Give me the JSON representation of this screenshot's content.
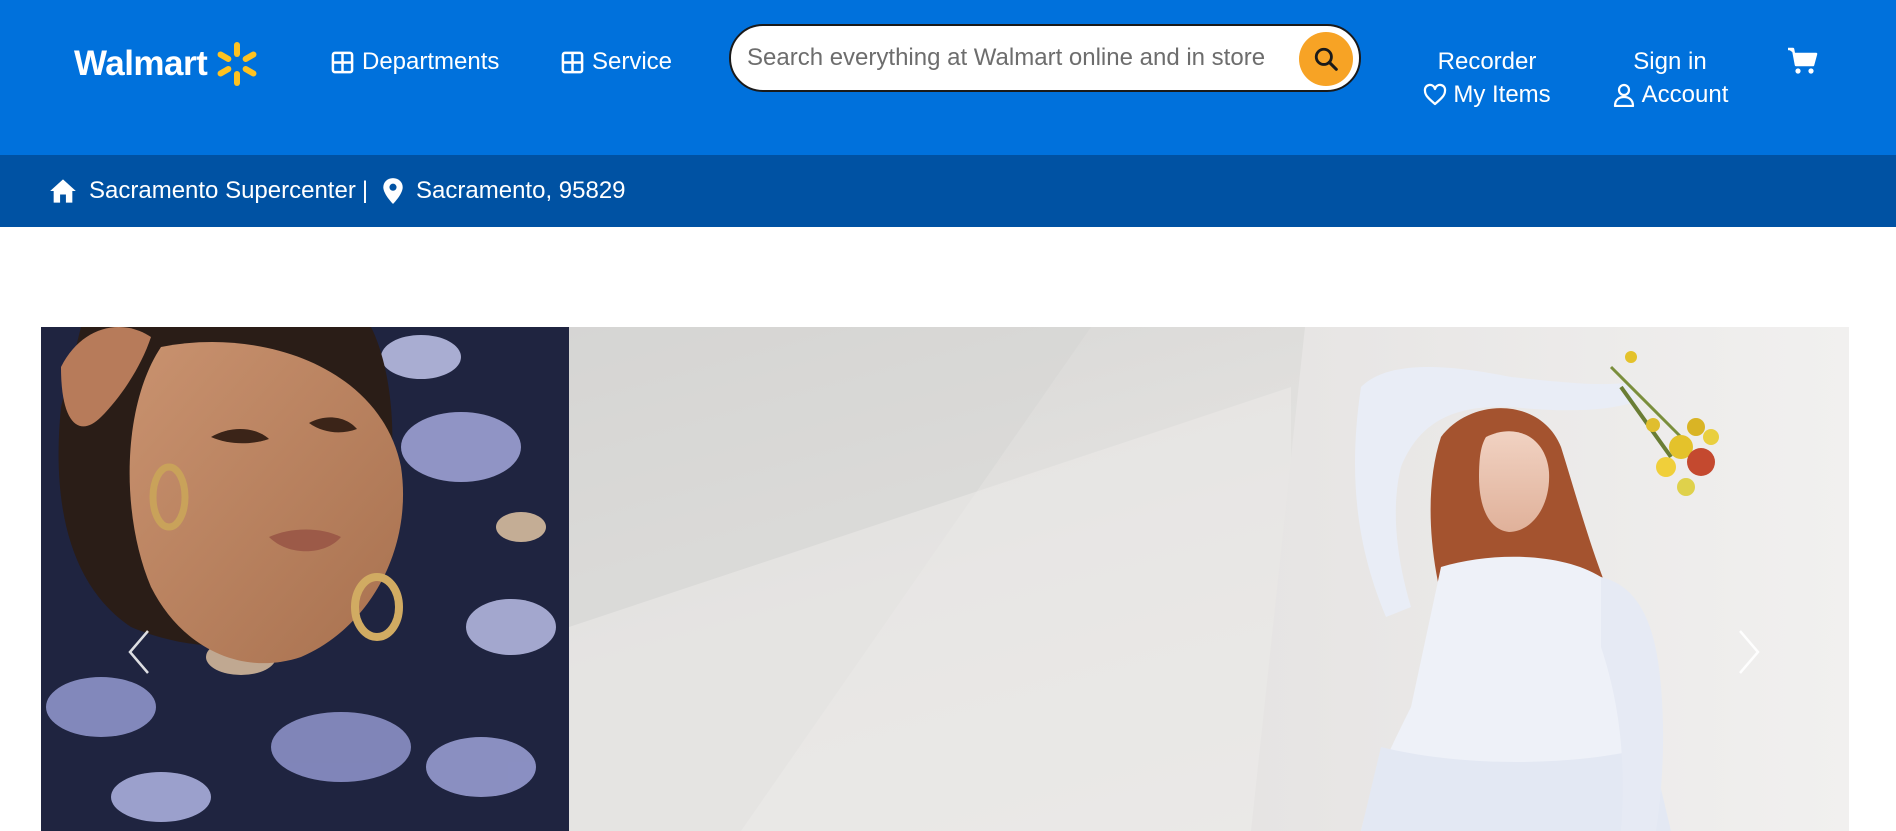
{
  "header": {
    "logo_text": "Walmart",
    "departments_label": "Departments",
    "service_label": "Service",
    "search": {
      "placeholder": "Search everything at Walmart online and in store"
    },
    "reorder_label": "Recorder",
    "my_items_label": "My Items",
    "sign_in_label": "Sign in",
    "account_label": "Account",
    "colors": {
      "brand_blue": "#0071dc",
      "location_blue": "#0052a3",
      "spark_yellow": "#ffc220",
      "search_button": "#f7a325"
    },
    "icons": [
      "spark-logo-icon",
      "grid-icon",
      "search-icon",
      "heart-icon",
      "user-icon",
      "cart-icon"
    ]
  },
  "location": {
    "store": "Sacramento Supercenter",
    "separator": "|",
    "city_zip": "Sacramento, 95829",
    "icons": [
      "home-icon",
      "location-pin-icon"
    ]
  },
  "hero": {
    "icons": [
      "chevron-left-icon",
      "chevron-right-icon"
    ]
  }
}
